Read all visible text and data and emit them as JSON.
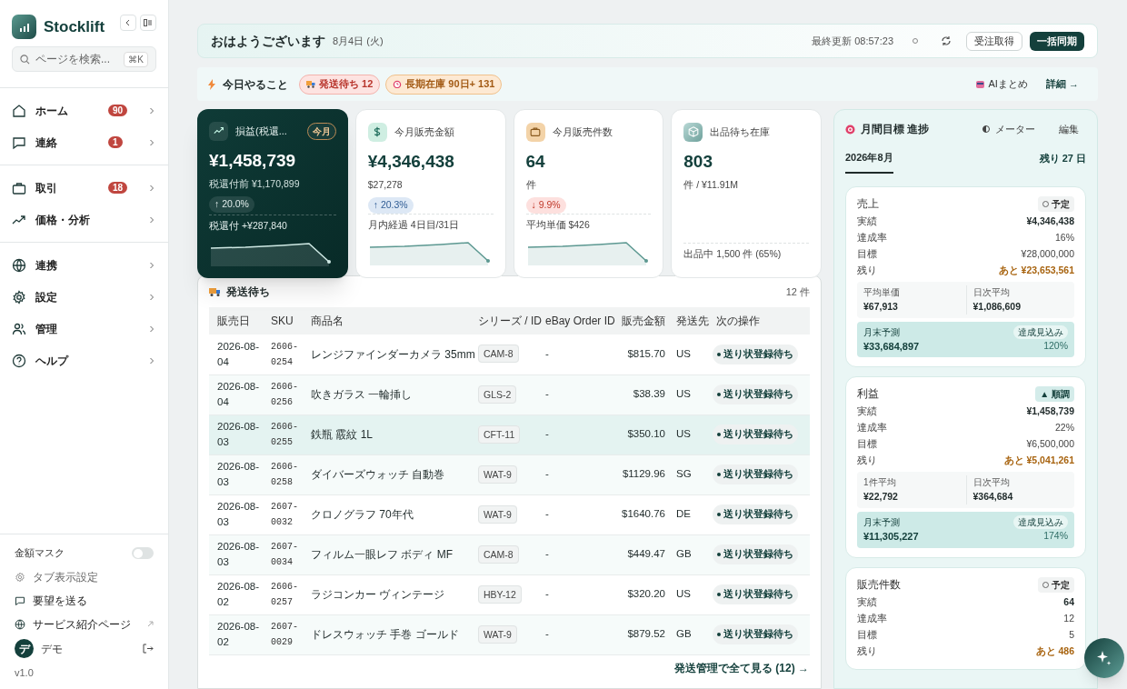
{
  "app": {
    "name": "Stocklift",
    "search_placeholder": "ページを検索...",
    "search_shortcut": "⌘K"
  },
  "nav_groups": [
    [
      {
        "label": "ホーム",
        "badge": "90"
      },
      {
        "label": "連絡",
        "badge": "1"
      }
    ],
    [
      {
        "label": "取引",
        "badge": "18"
      },
      {
        "label": "価格・分析"
      }
    ],
    [
      {
        "label": "連携"
      },
      {
        "label": "設定"
      },
      {
        "label": "管理"
      },
      {
        "label": "ヘルプ"
      }
    ]
  ],
  "sidebar_footer": {
    "mask": {
      "label": "金額マスク",
      "on": false
    },
    "links": [
      {
        "label": "タブ表示設定",
        "muted": true
      },
      {
        "label": "要望を送る",
        "muted": false
      },
      {
        "label": "サービス紹介ページ",
        "muted": false,
        "external": true
      }
    ],
    "user": {
      "initial": "デ",
      "name": "デモ"
    },
    "version": "v1.0"
  },
  "header": {
    "greeting": "おはようございます",
    "date": "8月4日 (火)",
    "updated": "最終更新 08:57:23",
    "buttons": [
      {
        "label": "受注取得",
        "primary": false
      },
      {
        "label": "一括同期",
        "primary": true
      }
    ]
  },
  "today": {
    "title": "今日やること",
    "chips": [
      {
        "label": "発送待ち 12",
        "kind": "danger"
      },
      {
        "label": "長期在庫 90日+ 131",
        "kind": "warning"
      }
    ],
    "ai": "AIまとめ",
    "detail": "詳細 →"
  },
  "kpis": [
    {
      "title": "損益(税還...",
      "featured": true,
      "tag": "今月",
      "value": "¥1,458,739",
      "sub": "税還付前 ¥1,170,899",
      "change": {
        "text": "↑ 20.0%",
        "kind": "up"
      },
      "note": "税還付 +¥287,840"
    },
    {
      "title": "今月販売金額",
      "featured": false,
      "value": "¥4,346,438",
      "sub": "$27,278",
      "change": {
        "text": "↑ 20.3%",
        "kind": "up"
      },
      "note": "月内経過 4日目/31日"
    },
    {
      "title": "今月販売件数",
      "featured": false,
      "value": "64",
      "sub": "件",
      "change": {
        "text": "↓ 9.9%",
        "kind": "down"
      },
      "note": "平均単価 $426"
    },
    {
      "title": "出品待ち在庫",
      "featured": false,
      "value": "803",
      "sub": "件 / ¥11.91M",
      "note": "出品中 1,500 件 (65%)"
    }
  ],
  "shipping": {
    "title": "発送待ち",
    "count": "12 件",
    "columns": [
      "販売日",
      "SKU",
      "商品名",
      "シリーズ / ID",
      "eBay Order ID",
      "販売金額",
      "発送先",
      "次の操作"
    ],
    "rows": [
      {
        "date": "2026-08-04",
        "sku": "2606-0254",
        "name": "レンジファインダーカメラ 35mm",
        "series": "CAM-8",
        "order": "-",
        "amount": "$815.70",
        "dest": "US",
        "action": "送り状登録待ち",
        "selected": false
      },
      {
        "date": "2026-08-04",
        "sku": "2606-0256",
        "name": "吹きガラス 一輪挿し",
        "series": "GLS-2",
        "order": "-",
        "amount": "$38.39",
        "dest": "US",
        "action": "送り状登録待ち",
        "selected": false
      },
      {
        "date": "2026-08-03",
        "sku": "2606-0255",
        "name": "鉄瓶 霰紋 1L",
        "series": "CFT-11",
        "order": "-",
        "amount": "$350.10",
        "dest": "US",
        "action": "送り状登録待ち",
        "selected": true
      },
      {
        "date": "2026-08-03",
        "sku": "2606-0258",
        "name": "ダイバーズウォッチ 自動巻",
        "series": "WAT-9",
        "order": "-",
        "amount": "$1129.96",
        "dest": "SG",
        "action": "送り状登録待ち",
        "selected": false
      },
      {
        "date": "2026-08-03",
        "sku": "2607-0032",
        "name": "クロノグラフ 70年代",
        "series": "WAT-9",
        "order": "-",
        "amount": "$1640.76",
        "dest": "DE",
        "action": "送り状登録待ち",
        "selected": false
      },
      {
        "date": "2026-08-03",
        "sku": "2607-0034",
        "name": "フィルム一眼レフ ボディ MF",
        "series": "CAM-8",
        "order": "-",
        "amount": "$449.47",
        "dest": "GB",
        "action": "送り状登録待ち",
        "selected": false
      },
      {
        "date": "2026-08-02",
        "sku": "2606-0257",
        "name": "ラジコンカー ヴィンテージ",
        "series": "HBY-12",
        "order": "-",
        "amount": "$320.20",
        "dest": "US",
        "action": "送り状登録待ち",
        "selected": false
      },
      {
        "date": "2026-08-02",
        "sku": "2607-0029",
        "name": "ドレスウォッチ 手巻 ゴールド",
        "series": "WAT-9",
        "order": "-",
        "amount": "$879.52",
        "dest": "GB",
        "action": "送り状登録待ち",
        "selected": false
      }
    ],
    "footer_link": "発送管理で全て見る (12) →"
  },
  "goals": {
    "title": "月間目標 進捗",
    "meter": "メーター",
    "edit": "編集",
    "month": "2026年8月",
    "remaining_days": "残り 27 日",
    "cards": [
      {
        "title": "売上",
        "status": {
          "label": "予定",
          "kind": "plan"
        },
        "rows": [
          {
            "label": "実績",
            "value": "¥4,346,438",
            "kind": "strong"
          },
          {
            "label": "達成率",
            "value": "16%",
            "kind": "plain"
          },
          {
            "label": "目標",
            "value": "¥28,000,000",
            "kind": "plain"
          },
          {
            "label": "残り",
            "value": "あと ¥23,653,561",
            "kind": "warn"
          }
        ],
        "stats": [
          {
            "label": "平均単価",
            "value": "¥67,913"
          },
          {
            "label": "日次平均",
            "value": "¥1,086,609"
          }
        ],
        "forecast": {
          "label": "月末予測",
          "value": "¥33,684,897",
          "badge": "達成見込み",
          "percent": "120%"
        }
      },
      {
        "title": "利益",
        "status": {
          "label": "▲ 順調",
          "kind": "good"
        },
        "rows": [
          {
            "label": "実績",
            "value": "¥1,458,739",
            "kind": "strong"
          },
          {
            "label": "達成率",
            "value": "22%",
            "kind": "plain"
          },
          {
            "label": "目標",
            "value": "¥6,500,000",
            "kind": "plain"
          },
          {
            "label": "残り",
            "value": "あと ¥5,041,261",
            "kind": "warn"
          }
        ],
        "stats": [
          {
            "label": "1件平均",
            "value": "¥22,792"
          },
          {
            "label": "日次平均",
            "value": "¥364,684"
          }
        ],
        "forecast": {
          "label": "月末予測",
          "value": "¥11,305,227",
          "badge": "達成見込み",
          "percent": "174%"
        }
      },
      {
        "title": "販売件数",
        "status": {
          "label": "予定",
          "kind": "plan"
        },
        "rows": [
          {
            "label": "実績",
            "value": "64",
            "kind": "strong"
          },
          {
            "label": "達成率",
            "value": "12",
            "kind": "plain"
          },
          {
            "label": "目標",
            "value": "5",
            "kind": "plain"
          },
          {
            "label": "残り",
            "value": "あと 486",
            "kind": "warn"
          }
        ]
      }
    ]
  }
}
